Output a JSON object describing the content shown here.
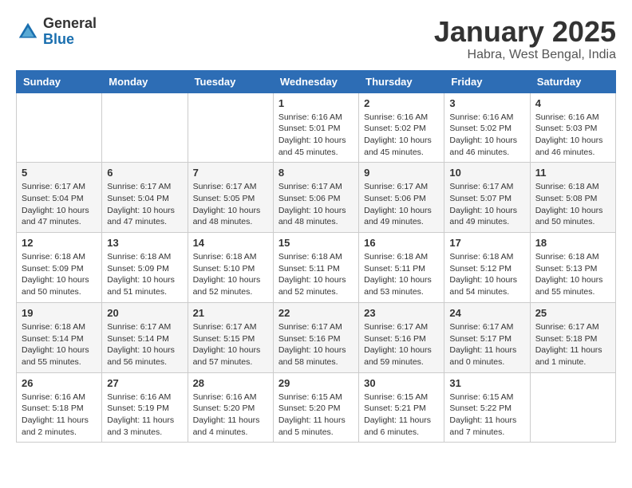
{
  "logo": {
    "general": "General",
    "blue": "Blue"
  },
  "header": {
    "title": "January 2025",
    "location": "Habra, West Bengal, India"
  },
  "weekdays": [
    "Sunday",
    "Monday",
    "Tuesday",
    "Wednesday",
    "Thursday",
    "Friday",
    "Saturday"
  ],
  "weeks": [
    [
      {
        "day": "",
        "info": ""
      },
      {
        "day": "",
        "info": ""
      },
      {
        "day": "",
        "info": ""
      },
      {
        "day": "1",
        "info": "Sunrise: 6:16 AM\nSunset: 5:01 PM\nDaylight: 10 hours and 45 minutes."
      },
      {
        "day": "2",
        "info": "Sunrise: 6:16 AM\nSunset: 5:02 PM\nDaylight: 10 hours and 45 minutes."
      },
      {
        "day": "3",
        "info": "Sunrise: 6:16 AM\nSunset: 5:02 PM\nDaylight: 10 hours and 46 minutes."
      },
      {
        "day": "4",
        "info": "Sunrise: 6:16 AM\nSunset: 5:03 PM\nDaylight: 10 hours and 46 minutes."
      }
    ],
    [
      {
        "day": "5",
        "info": "Sunrise: 6:17 AM\nSunset: 5:04 PM\nDaylight: 10 hours and 47 minutes."
      },
      {
        "day": "6",
        "info": "Sunrise: 6:17 AM\nSunset: 5:04 PM\nDaylight: 10 hours and 47 minutes."
      },
      {
        "day": "7",
        "info": "Sunrise: 6:17 AM\nSunset: 5:05 PM\nDaylight: 10 hours and 48 minutes."
      },
      {
        "day": "8",
        "info": "Sunrise: 6:17 AM\nSunset: 5:06 PM\nDaylight: 10 hours and 48 minutes."
      },
      {
        "day": "9",
        "info": "Sunrise: 6:17 AM\nSunset: 5:06 PM\nDaylight: 10 hours and 49 minutes."
      },
      {
        "day": "10",
        "info": "Sunrise: 6:17 AM\nSunset: 5:07 PM\nDaylight: 10 hours and 49 minutes."
      },
      {
        "day": "11",
        "info": "Sunrise: 6:18 AM\nSunset: 5:08 PM\nDaylight: 10 hours and 50 minutes."
      }
    ],
    [
      {
        "day": "12",
        "info": "Sunrise: 6:18 AM\nSunset: 5:09 PM\nDaylight: 10 hours and 50 minutes."
      },
      {
        "day": "13",
        "info": "Sunrise: 6:18 AM\nSunset: 5:09 PM\nDaylight: 10 hours and 51 minutes."
      },
      {
        "day": "14",
        "info": "Sunrise: 6:18 AM\nSunset: 5:10 PM\nDaylight: 10 hours and 52 minutes."
      },
      {
        "day": "15",
        "info": "Sunrise: 6:18 AM\nSunset: 5:11 PM\nDaylight: 10 hours and 52 minutes."
      },
      {
        "day": "16",
        "info": "Sunrise: 6:18 AM\nSunset: 5:11 PM\nDaylight: 10 hours and 53 minutes."
      },
      {
        "day": "17",
        "info": "Sunrise: 6:18 AM\nSunset: 5:12 PM\nDaylight: 10 hours and 54 minutes."
      },
      {
        "day": "18",
        "info": "Sunrise: 6:18 AM\nSunset: 5:13 PM\nDaylight: 10 hours and 55 minutes."
      }
    ],
    [
      {
        "day": "19",
        "info": "Sunrise: 6:18 AM\nSunset: 5:14 PM\nDaylight: 10 hours and 55 minutes."
      },
      {
        "day": "20",
        "info": "Sunrise: 6:17 AM\nSunset: 5:14 PM\nDaylight: 10 hours and 56 minutes."
      },
      {
        "day": "21",
        "info": "Sunrise: 6:17 AM\nSunset: 5:15 PM\nDaylight: 10 hours and 57 minutes."
      },
      {
        "day": "22",
        "info": "Sunrise: 6:17 AM\nSunset: 5:16 PM\nDaylight: 10 hours and 58 minutes."
      },
      {
        "day": "23",
        "info": "Sunrise: 6:17 AM\nSunset: 5:16 PM\nDaylight: 10 hours and 59 minutes."
      },
      {
        "day": "24",
        "info": "Sunrise: 6:17 AM\nSunset: 5:17 PM\nDaylight: 11 hours and 0 minutes."
      },
      {
        "day": "25",
        "info": "Sunrise: 6:17 AM\nSunset: 5:18 PM\nDaylight: 11 hours and 1 minute."
      }
    ],
    [
      {
        "day": "26",
        "info": "Sunrise: 6:16 AM\nSunset: 5:18 PM\nDaylight: 11 hours and 2 minutes."
      },
      {
        "day": "27",
        "info": "Sunrise: 6:16 AM\nSunset: 5:19 PM\nDaylight: 11 hours and 3 minutes."
      },
      {
        "day": "28",
        "info": "Sunrise: 6:16 AM\nSunset: 5:20 PM\nDaylight: 11 hours and 4 minutes."
      },
      {
        "day": "29",
        "info": "Sunrise: 6:15 AM\nSunset: 5:20 PM\nDaylight: 11 hours and 5 minutes."
      },
      {
        "day": "30",
        "info": "Sunrise: 6:15 AM\nSunset: 5:21 PM\nDaylight: 11 hours and 6 minutes."
      },
      {
        "day": "31",
        "info": "Sunrise: 6:15 AM\nSunset: 5:22 PM\nDaylight: 11 hours and 7 minutes."
      },
      {
        "day": "",
        "info": ""
      }
    ]
  ]
}
